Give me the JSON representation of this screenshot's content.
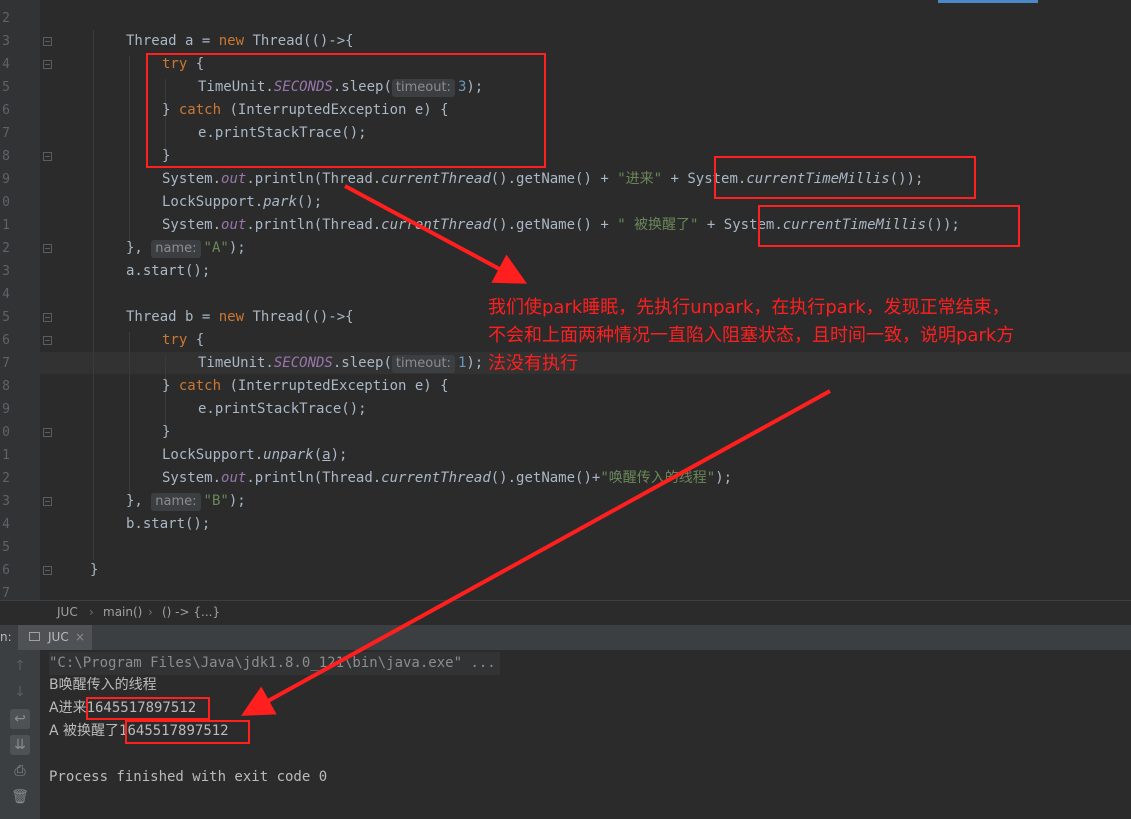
{
  "gutter": {
    "line_numbers": [
      "2",
      "3",
      "4",
      "5",
      "6",
      "7",
      "8",
      "9",
      "0",
      "1",
      "2",
      "3",
      "4",
      "5",
      "6",
      "7",
      "8",
      "9",
      "0",
      "1",
      "2",
      "3",
      "4",
      "5",
      "6",
      "7"
    ]
  },
  "code": {
    "thread_a_decl": [
      "Thread a = ",
      "new",
      " Thread(()->{"
    ],
    "try_kw": "try",
    "brace_open": " {",
    "sleep_prefix": "TimeUnit.",
    "sleep_field": "SECONDS",
    "sleep_call": ".sleep(",
    "timeout_hint": "timeout:",
    "sleep_a_arg": "3",
    "sleep_b_arg": "1",
    "sleep_suffix": ");",
    "catch_open": "} ",
    "catch_kw": "catch",
    "catch_rest": " (InterruptedException e) {",
    "print_stack": "e.printStackTrace();",
    "close_brace": "}",
    "sys_prefix": "System.",
    "out_field": "out",
    "println_open": ".println(Thread.",
    "current_thread": "currentThread",
    "get_name": "().getName() + ",
    "str_enter": "\"进来\"",
    "plus": " + ",
    "millis_prefix": "System.",
    "millis_call": "currentTimeMillis",
    "millis_suffix": "());",
    "lock_prefix": "LockSupport.",
    "park_call": "park",
    "park_suffix": "();",
    "str_woken": "\" 被换醒了\"",
    "close_a_prefix": "},",
    "name_hint": "name:",
    "name_a": "\"A\"",
    "name_b": "\"B\"",
    "close_suffix": ");",
    "a_start": "a.start();",
    "thread_b_decl": [
      "Thread b = ",
      "new",
      " Thread(()->{"
    ],
    "unpark_call": "unpark",
    "unpark_arg": "a",
    "unpark_open": "(",
    "println_b_get_name": "().getName()+",
    "str_b_wake": "\"唤醒传入的线程\"",
    "println_b_suffix": ");",
    "b_start": "b.start();",
    "method_close": "}"
  },
  "annotation": {
    "text_lines": [
      "我们使park睡眠，先执行unpark，在执行park，发现正常结束，",
      "不会和上面两种情况一直陷入阻塞状态，且时间一致，说明park方",
      "法没有执行"
    ],
    "color": "#ff1f1f"
  },
  "breadcrumb": {
    "items": [
      "JUC",
      "main()",
      "() -> {...}"
    ],
    "separator": "›"
  },
  "run_panel": {
    "prefix": "n:",
    "tab_label": "JUC",
    "close_glyph": "×"
  },
  "console": {
    "cmd_line": "\"C:\\Program Files\\Java\\jdk1.8.0_121\\bin\\java.exe\" ...",
    "line_b": "B唤醒传入的线程",
    "line_a_label": "A进来",
    "line_a_value": "1645517897512",
    "line_a2_label": "A 被换醒了",
    "line_a2_value": "1645517897512",
    "exit_line": "Process finished with exit code 0"
  },
  "toolbar_icons": [
    "arrow-up-icon",
    "arrow-down-icon",
    "soft-wrap-icon",
    "scroll-end-icon",
    "print-icon",
    "trash-icon"
  ],
  "colors": {
    "keyword": "#cc7832",
    "string": "#6a8759",
    "number": "#6897bb",
    "field": "#9876aa",
    "highlight_box": "#ff2020"
  }
}
